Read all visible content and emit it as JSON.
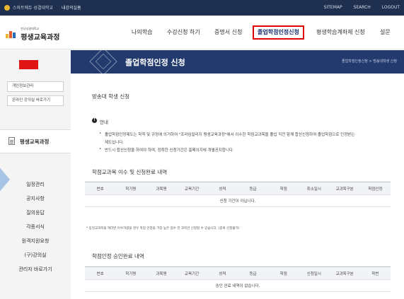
{
  "topbar": {
    "brand": "스마트에듀 성결대학교",
    "site": "내강의실홈",
    "links": [
      "SITEMAP",
      "SEARCH",
      "LOGOUT"
    ],
    "colors": {
      "bg": "#1f2f4f",
      "accent": "#e8b92f"
    }
  },
  "header": {
    "logo_small": "한국성결대학교",
    "logo_big": "평생교육과정",
    "nav": [
      "나의학습",
      "수강신청 하기",
      "증명서 신청",
      "졸업학점인정신청",
      "평생학습계좌제 신청",
      "설문"
    ],
    "active_nav": "졸업학점인정신청"
  },
  "sidebar": {
    "buttons": [
      "개인정보관리",
      "온라인 강의실 바로가기"
    ],
    "menu_title": "평생교육과정",
    "items": [
      "일정관리",
      "공지사항",
      "질의응답",
      "각종서식",
      "원격지원요청",
      "(구)강의실",
      "관리자 바로가기"
    ]
  },
  "banner": {
    "title": "졸업학점인정 신청",
    "breadcrumb": "졸업학점인정신청 > 방송대학생 신청"
  },
  "content": {
    "page_heading": "방송대 학생 신청",
    "notice_icon": "!",
    "notice_title": "안내",
    "notice_lines": [
      "졸업학점인정제도는 학칙 및 규정에 의거하여 \"프라임칼리지 평생교육과정\"에서 이수한 학점교과목을 졸업 직전 함께 합산신청하여 졸업학점으로 인정받는",
      "제도입니다.",
      "반드시 합산신청을 하여야 하며, 정확한 신청기간은 홈페이지에 개별공지합니다."
    ],
    "table1_title": "학점교과목 이수 및 신청완료 내역",
    "table1_headers": [
      "번호",
      "학기명",
      "과목명",
      "교육기간",
      "성적",
      "등급",
      "학점",
      "취소일시",
      "교과목구분",
      "학점인정"
    ],
    "table1_empty": "신청 기간이 아닙니다.",
    "footnote": "* 동일교과목을 여러번 이수하였을 경우 학점 인정을 가장 높은 점수 한 과목만 신청할 수 있습니다. (중복 신청불가)",
    "table2_title": "학점인정 승인완료 내역",
    "table2_headers": [
      "번호",
      "학기명",
      "과목명",
      "교육기간",
      "성적",
      "등급",
      "학점",
      "신청일시",
      "교과목구분",
      "학번"
    ],
    "table2_empty": "승인 완료 내역이 없습니다."
  }
}
